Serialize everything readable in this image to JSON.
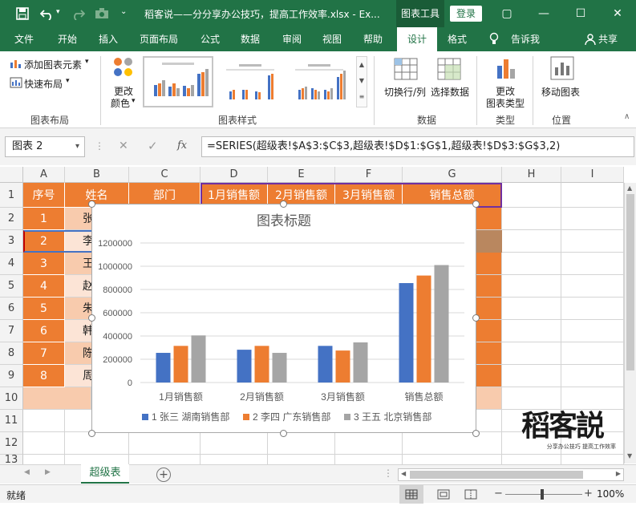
{
  "titlebar": {
    "title": "稻客说——分分享办公技巧，提高工作效率.xlsx  -  Ex...",
    "context_tab": "图表工具",
    "login": "登录"
  },
  "menu": {
    "items": [
      "文件",
      "开始",
      "插入",
      "页面布局",
      "公式",
      "数据",
      "审阅",
      "视图",
      "帮助",
      "设计",
      "格式",
      "告诉我",
      "共享"
    ],
    "active": "设计"
  },
  "ribbon": {
    "add_element": "添加图表元素",
    "quick_layout": "快速布局",
    "change_colors_1": "更改",
    "change_colors_2": "颜色",
    "group_layout": "图表布局",
    "group_styles": "图表样式",
    "switch_row_col": "切换行/列",
    "select_data": "选择数据",
    "group_data": "数据",
    "change_type_1": "更改",
    "change_type_2": "图表类型",
    "group_type": "类型",
    "move_chart": "移动图表",
    "group_location": "位置"
  },
  "formula_bar": {
    "name_box": "图表 2",
    "fx": "fx",
    "formula": "=SERIES(超级表!$A$3:$C$3,超级表!$D$1:$G$1,超级表!$D$3:$G$3,2)"
  },
  "grid": {
    "columns": [
      "A",
      "B",
      "C",
      "D",
      "E",
      "F",
      "G",
      "H",
      "I"
    ],
    "rows": [
      "1",
      "2",
      "3",
      "4",
      "5",
      "6",
      "7",
      "8",
      "9",
      "10",
      "11",
      "12",
      "13"
    ],
    "header": [
      "序号",
      "姓名",
      "部门",
      "1月销售额",
      "2月销售额",
      "3月销售额",
      "销售总额"
    ],
    "seq": [
      "1",
      "2",
      "3",
      "4",
      "5",
      "6",
      "7",
      "8"
    ],
    "name_fragments": [
      "张",
      "李",
      "王",
      "赵",
      "朱",
      "韩",
      "陈",
      "周"
    ]
  },
  "chart_data": {
    "type": "bar",
    "title": "图表标题",
    "categories": [
      "1月销售额",
      "2月销售额",
      "3月销售额",
      "销售总额"
    ],
    "series": [
      {
        "name": "1 张三 湖南销售部",
        "color": "#4472c4",
        "values": [
          255000,
          282000,
          315000,
          855000
        ]
      },
      {
        "name": "2 李四 广东销售部",
        "color": "#ed7d31",
        "values": [
          315000,
          315000,
          275000,
          920000
        ]
      },
      {
        "name": "3 王五 北京销售部",
        "color": "#a5a5a5",
        "values": [
          405000,
          255000,
          345000,
          1010000
        ]
      }
    ],
    "yticks": [
      "0",
      "200000",
      "400000",
      "600000",
      "800000",
      "1000000",
      "1200000"
    ],
    "ylim": [
      0,
      1200000
    ],
    "grid": true,
    "legend": "bottom"
  },
  "watermark": {
    "logo": "稻客説",
    "slogan": "分享办公技巧  提高工作效率"
  },
  "sheet": {
    "tab": "超级表",
    "add": "+"
  },
  "status": {
    "ready": "就绪",
    "zoom": "100%"
  }
}
